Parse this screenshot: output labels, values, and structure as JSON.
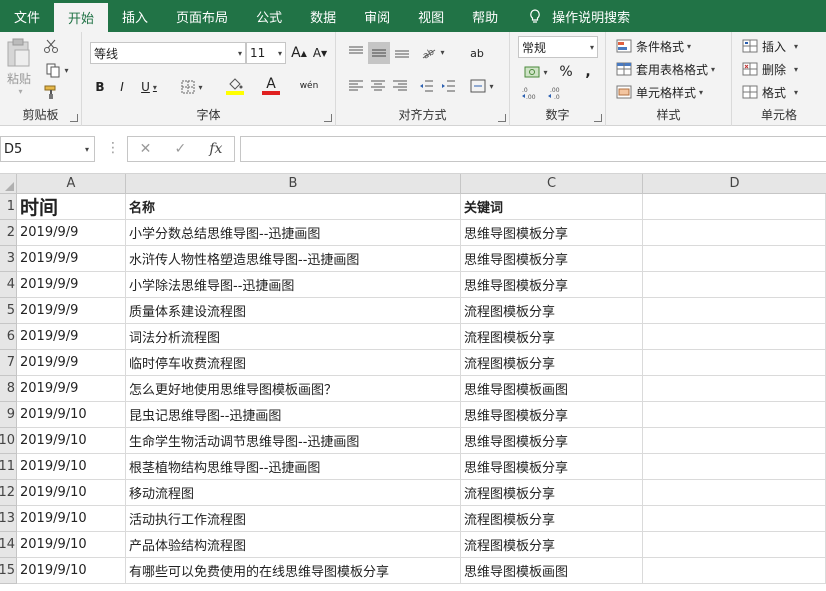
{
  "menu": {
    "tabs": [
      "文件",
      "开始",
      "插入",
      "页面布局",
      "公式",
      "数据",
      "审阅",
      "视图",
      "帮助"
    ],
    "active": "开始",
    "tell_me": "操作说明搜索"
  },
  "ribbon": {
    "clipboard": {
      "label": "剪贴板",
      "paste": "粘贴"
    },
    "font": {
      "label": "字体",
      "font_name": "等线",
      "font_size": "11",
      "bold": "B",
      "italic": "I",
      "underline": "U",
      "grow": "A",
      "shrink": "A",
      "phonetic": "wén",
      "font_color": "A"
    },
    "alignment": {
      "label": "对齐方式",
      "wrap_icon": "ab"
    },
    "number": {
      "label": "数字",
      "format": "常规",
      "percent": "%",
      "comma": ","
    },
    "styles": {
      "label": "样式",
      "conditional": "条件格式",
      "table": "套用表格格式",
      "cell_styles": "单元格样式"
    },
    "cells": {
      "label": "单元格",
      "insert": "插入",
      "delete": "删除",
      "format": "格式"
    }
  },
  "formula_bar": {
    "name_box": "D5",
    "cancel": "✕",
    "enter": "✓",
    "fx": "fx",
    "value": ""
  },
  "sheet": {
    "columns": [
      "A",
      "B",
      "C",
      "D"
    ],
    "rows": [
      {
        "num": "1",
        "a": "时间",
        "b": "名称",
        "c": "关键词"
      },
      {
        "num": "2",
        "a": "2019/9/9",
        "b": "小学分数总结思维导图--迅捷画图",
        "c": "思维导图模板分享"
      },
      {
        "num": "3",
        "a": "2019/9/9",
        "b": "水浒传人物性格塑造思维导图--迅捷画图",
        "c": "思维导图模板分享"
      },
      {
        "num": "4",
        "a": "2019/9/9",
        "b": "小学除法思维导图--迅捷画图",
        "c": "思维导图模板分享"
      },
      {
        "num": "5",
        "a": "2019/9/9",
        "b": "质量体系建设流程图",
        "c": "流程图模板分享"
      },
      {
        "num": "6",
        "a": "2019/9/9",
        "b": "词法分析流程图",
        "c": "流程图模板分享"
      },
      {
        "num": "7",
        "a": "2019/9/9",
        "b": "临时停车收费流程图",
        "c": "流程图模板分享"
      },
      {
        "num": "8",
        "a": "2019/9/9",
        "b": "怎么更好地使用思维导图模板画图？",
        "c": "思维导图模板画图"
      },
      {
        "num": "9",
        "a": "2019/9/10",
        "b": "昆虫记思维导图--迅捷画图",
        "c": "思维导图模板分享"
      },
      {
        "num": "10",
        "a": "2019/9/10",
        "b": "生命学生物活动调节思维导图--迅捷画图",
        "c": "思维导图模板分享"
      },
      {
        "num": "11",
        "a": "2019/9/10",
        "b": "根茎植物结构思维导图--迅捷画图",
        "c": "思维导图模板分享"
      },
      {
        "num": "12",
        "a": "2019/9/10",
        "b": "移动流程图",
        "c": "流程图模板分享"
      },
      {
        "num": "13",
        "a": "2019/9/10",
        "b": "活动执行工作流程图",
        "c": "流程图模板分享"
      },
      {
        "num": "14",
        "a": "2019/9/10",
        "b": "产品体验结构流程图",
        "c": "流程图模板分享"
      },
      {
        "num": "15",
        "a": "2019/9/10",
        "b": "有哪些可以免费使用的在线思维导图模板分享",
        "c": "思维导图模板画图"
      }
    ]
  },
  "colors": {
    "accent": "#217346",
    "font_color_bar": "#e02020",
    "fill_color_bar": "#ffff00"
  }
}
